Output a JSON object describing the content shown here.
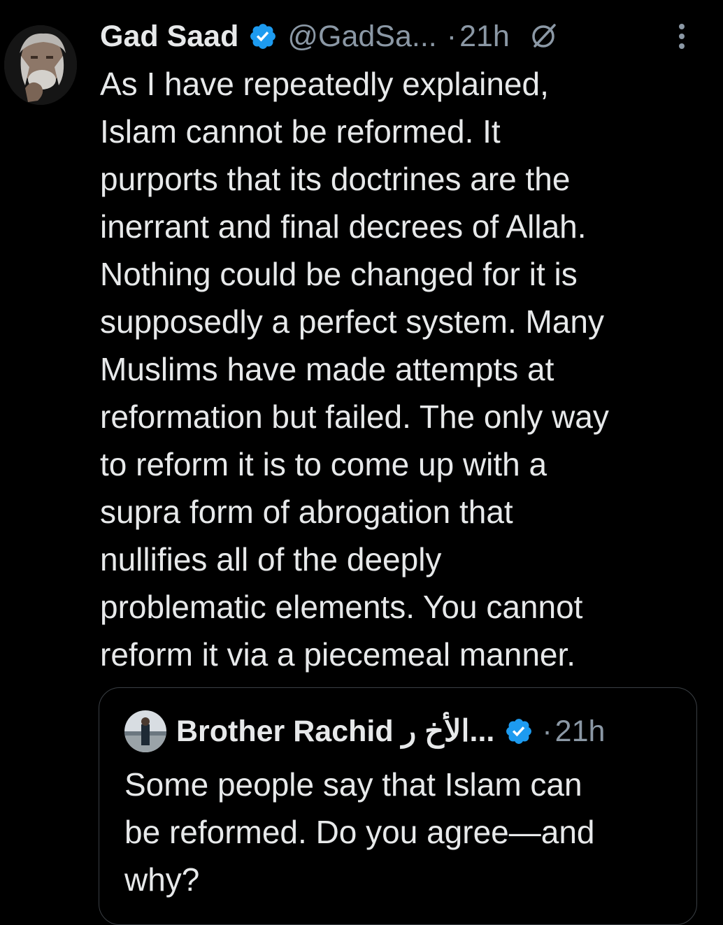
{
  "tweet": {
    "author_name": "Gad Saad",
    "handle": "@GadSa...",
    "separator": "·",
    "time": "21h",
    "text": "As I have repeatedly explained,\nIslam cannot be reformed.  It\npurports that its doctrines are the\ninerrant and final decrees of Allah.\nNothing could be changed for it is\nsupposedly a perfect system.   Many\nMuslims have made attempts at\nreformation but failed.  The only way\nto reform it is to come up with a\nsupra form of abrogation that\nnullifies all of the deeply\nproblematic elements.  You cannot\nreform it via a piecemeal manner.",
    "icons": {
      "avatar": "avatar",
      "verified": "verified-badge-icon",
      "grok": "grok-icon",
      "more": "more-options-icon"
    }
  },
  "quoted_tweet": {
    "author_name": "Brother Rachid الأخ ر...",
    "separator": "·",
    "time": "21h",
    "text": "Some people say that Islam can\nbe reformed. Do you agree—and\nwhy?"
  },
  "colors": {
    "background": "#000000",
    "primary_text": "#e7e9ea",
    "secondary_text": "#8b98a5",
    "verified_blue": "#1d9bf0",
    "quote_border": "#3a3f44"
  }
}
